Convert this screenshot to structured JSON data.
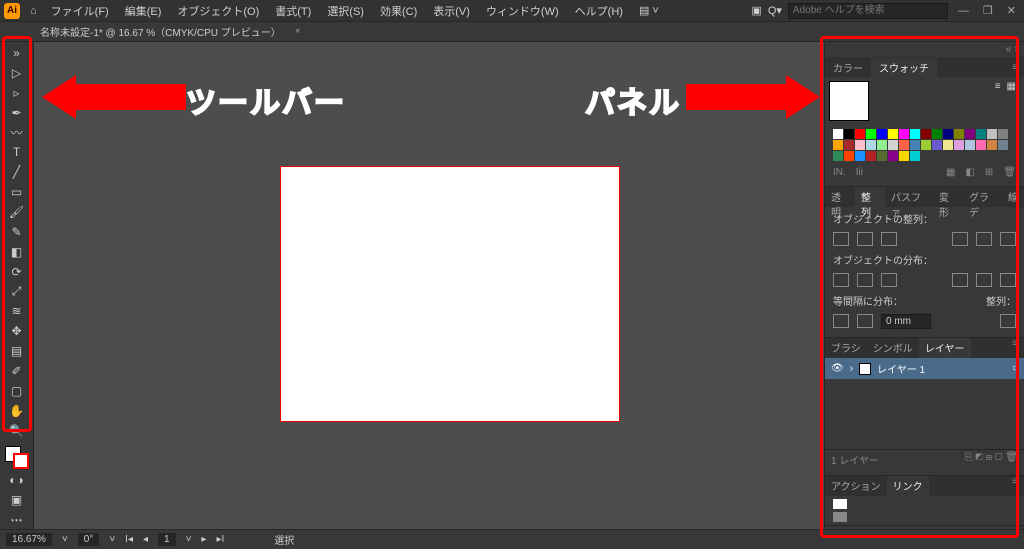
{
  "menubar": {
    "items": [
      "ファイル(F)",
      "編集(E)",
      "オブジェクト(O)",
      "書式(T)",
      "選択(S)",
      "効果(C)",
      "表示(V)",
      "ウィンドウ(W)",
      "ヘルプ(H)"
    ],
    "search_placeholder": "Adobe ヘルプを検索"
  },
  "docbar": {
    "tab_label": "名称未設定-1* @ 16.67 %（CMYK/CPU プレビュー）"
  },
  "tools": {
    "names": [
      "selection",
      "direct-selection",
      "pen",
      "curvature",
      "type",
      "line",
      "rectangle",
      "paintbrush",
      "pencil",
      "eraser",
      "rotate",
      "scale",
      "width",
      "free-transform",
      "gradient",
      "eyedropper",
      "blend",
      "symbol-sprayer",
      "column-graph",
      "artboard",
      "slice",
      "hand",
      "zoom"
    ]
  },
  "panels": {
    "color_tabs": {
      "a": "カラー",
      "b": "スウォッチ"
    },
    "swatch_colors": [
      "#ffffff",
      "#000000",
      "#ff0000",
      "#00ff00",
      "#0000ff",
      "#ffff00",
      "#ff00ff",
      "#00ffff",
      "#800000",
      "#008000",
      "#000080",
      "#808000",
      "#800080",
      "#008080",
      "#c0c0c0",
      "#808080",
      "#ffa500",
      "#a52a2a",
      "#ffc0cb",
      "#add8e6",
      "#90ee90",
      "#d3d3d3",
      "#ff6347",
      "#4682b4",
      "#9acd32",
      "#6a5acd",
      "#f0e68c",
      "#dda0dd",
      "#b0c4de",
      "#ff69b4",
      "#cd853f",
      "#708090",
      "#2e8b57",
      "#ff4500",
      "#1e90ff",
      "#b22222",
      "#556b2f",
      "#8b008b",
      "#ffd700",
      "#00ced1"
    ],
    "swatch_footer": [
      "IN.",
      "Iii",
      "▦",
      "◧",
      "⊞",
      "🗑"
    ],
    "align_tabs": [
      "透明",
      "整列",
      "パスファ",
      "変形",
      "グラデ",
      "線"
    ],
    "align_section1": "オブジェクトの整列：",
    "align_section2": "オブジェクトの分布：",
    "align_section3_left": "等間隔に分布：",
    "align_section3_right": "整列：",
    "spacing_value": "0 mm",
    "layer_tabs": [
      "ブラシ",
      "シンボル",
      "レイヤー"
    ],
    "layer_name": "レイヤー 1",
    "layer_footer_left": "1 レイヤー",
    "action_tabs": [
      "アクション",
      "リンク"
    ]
  },
  "statusbar": {
    "zoom": "16.67%",
    "rotation": "0°",
    "artboard_nav": "1",
    "tool": "選択"
  },
  "annotations": {
    "toolbar_label": "ツールバー",
    "panel_label": "パネル"
  }
}
